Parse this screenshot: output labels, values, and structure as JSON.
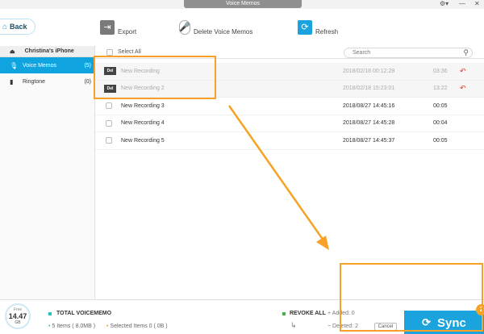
{
  "window": {
    "title": "Voice Memos",
    "settings_icon": "gear-icon",
    "minimize": "—",
    "close": "✕"
  },
  "toolbar": {
    "back_label": "Back",
    "export_label": "Export",
    "delete_label": "Delete Voice Memos",
    "refresh_label": "Refresh"
  },
  "sidebar": {
    "device": "Christina's iPhone",
    "items": [
      {
        "label": "Voice Memos",
        "count": "(5)"
      },
      {
        "label": "Ringtone",
        "count": "(0)"
      }
    ]
  },
  "list": {
    "select_all": "Select All",
    "search_placeholder": "Search",
    "del_badge": "Del",
    "rows": [
      {
        "name": "New Recording",
        "date": "2018/02/18 00:12:28",
        "duration": "03:36",
        "deleted": true
      },
      {
        "name": "New Recording 2",
        "date": "2018/02/18 15:23:01",
        "duration": "13:22",
        "deleted": true
      },
      {
        "name": "New Recording 3",
        "date": "2018/08/27 14:45:16",
        "duration": "00:05",
        "deleted": false
      },
      {
        "name": "New Recording 4",
        "date": "2018/08/27 14:45:28",
        "duration": "00:04",
        "deleted": false
      },
      {
        "name": "New Recording 5",
        "date": "2018/08/27 14:45:37",
        "duration": "00:05",
        "deleted": false
      }
    ]
  },
  "bottom": {
    "storage_label": "Free",
    "storage_value": "14.47",
    "storage_unit": "GB",
    "total_title": "TOTAL VOICEMEMO",
    "items_text": "5 Items ( 8.0MB )",
    "selected_text": "Selected Items 0 ( 0B )",
    "revoke_all": "REVOKE ALL",
    "added": "Added: 0",
    "deleted": "Deleted: 2",
    "cancel": "Cancel",
    "sync": "Sync",
    "sync_badge": "2"
  },
  "colors": {
    "accent": "#1aa3dc",
    "annotation": "#f7a226",
    "revoke": "#e1382e",
    "total_dot": "#1ec6c0",
    "revoke_dot": "#3db54a"
  }
}
